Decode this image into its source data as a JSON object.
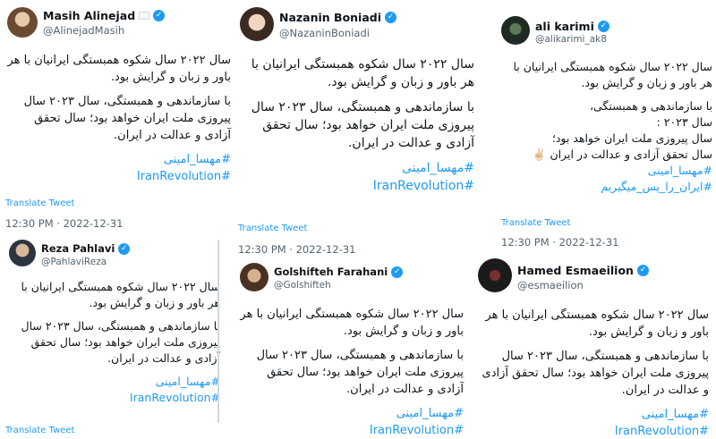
{
  "tweets": [
    {
      "name": "Masih Alinejad",
      "handle": "@AlinejadMasih",
      "badge": "",
      "para1": "سال ۲۰۲۲ سال شکوه همبستگی ایرانیان با هر باور و زبان و گرایش بود.",
      "para2": "با سازماندهی و همبستگی، سال ۲۰۲۳ سال پیروزی ملت ایران خواهد بود؛ سال تحقق آزادی و عدالت در ایران.",
      "tag1": "#مهسا_امینی",
      "tag2": "#IranRevolution",
      "translate": "Translate Tweet",
      "time": "12:30 PM · 2022-12-31"
    },
    {
      "name": "Nazanin Boniadi",
      "handle": "@NazaninBoniadi",
      "para1": "سال ۲۰۲۲ سال شکوه همبستگی ایرانیان با هر باور و زبان و گرایش بود.",
      "para2": "با سازماندهی و همبستگی، سال ۲۰۲۳ سال پیروزی ملت ایران خواهد بود؛ سال تحقق آزادی و عدالت در ایران.",
      "tag1": "#مهسا_امینی",
      "tag2": "#IranRevolution",
      "translate": "Translate Tweet",
      "time": "12:30 PM · 2022-12-31"
    },
    {
      "name": "ali karimi",
      "handle": "@alikarimi_ak8",
      "para1": "سال ۲۰۲۲ سال شکوه همبستگی ایرانیان با هر باور و زبان و گرایش بود.",
      "para2a": "با سازماندهی و همبستگی،",
      "para2b": "سال ۲۰۲۳ :",
      "para2c": "سال پیروزی ملت ایران خواهد بود؛",
      "para2d": "سال تحقق آزادی و عدالت در ایران ✌🏻",
      "tag1": "#مهسا_امینی",
      "tag2": "#ایران_را_پس_میگیریم",
      "translate": "Translate Tweet",
      "time": "12:30 PM · 2022-12-31"
    },
    {
      "name": "Reza Pahlavi",
      "handle": "@PahlaviReza",
      "para1": "سال ۲۰۲۲ سال شکوه همبستگی ایرانیان با هر باور و زبان و گرایش بود.",
      "para2": "با سازماندهی و همبستگی، سال ۲۰۲۳ سال پیروزی ملت ایران خواهد بود؛ سال تحقق آزادی و عدالت در ایران.",
      "tag1": "#مهسا_امینی",
      "tag2": "#IranRevolution",
      "translate": "Translate Tweet"
    },
    {
      "name": "Golshifteh Farahani",
      "handle": "@Golshifteh",
      "para1": "سال ۲۰۲۲ سال شکوه همبستگی ایرانیان با هر باور و زبان و گرایش بود.",
      "para2": "با سازماندهی و همبستگی، سال ۲۰۲۳ سال پیروزی ملت ایران خواهد بود؛ سال تحقق آزادی و عدالت در ایران.",
      "tag1": "#مهسا_امینی",
      "tag2": "#IranRevolution"
    },
    {
      "name": "Hamed Esmaeilion",
      "handle": "@esmaeilion",
      "para1": "سال ۲۰۲۲ سال شکوه همبستگی ایرانیان با هر باور و زبان و گرایش بود.",
      "para2": "با سازماندهی و همبستگی، سال ۲۰۲۳ سال پیروزی ملت ایران خواهد بود؛ سال تحقق آزادی و عدالت در ایران.",
      "tag1": "#مهسا_امینی",
      "tag2": "#IranRevolution"
    }
  ],
  "colors": {
    "link": "#1d9bf0",
    "muted": "#536471",
    "verified": "#1d9bf0"
  }
}
